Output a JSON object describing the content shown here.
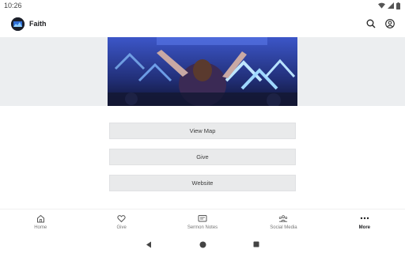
{
  "status_bar": {
    "time": "10:26"
  },
  "app_bar": {
    "title": "Faith",
    "actions": [
      "search-icon",
      "account-icon"
    ]
  },
  "colors": {
    "hero_blue": "#2a3a8a",
    "band_gray": "#eceef0",
    "button_gray": "#e9eaeb"
  },
  "actions": [
    {
      "label": "View Map"
    },
    {
      "label": "Give"
    },
    {
      "label": "Website"
    }
  ],
  "bottom_nav": {
    "items": [
      {
        "label": "Home",
        "icon": "home-icon"
      },
      {
        "label": "Give",
        "icon": "heart-icon"
      },
      {
        "label": "Sermon Notes",
        "icon": "notes-icon"
      },
      {
        "label": "Social Media",
        "icon": "people-icon"
      },
      {
        "label": "More",
        "icon": "more-icon",
        "active": true
      }
    ]
  },
  "system_nav": [
    "back-icon",
    "home-circle-icon",
    "recents-icon"
  ]
}
